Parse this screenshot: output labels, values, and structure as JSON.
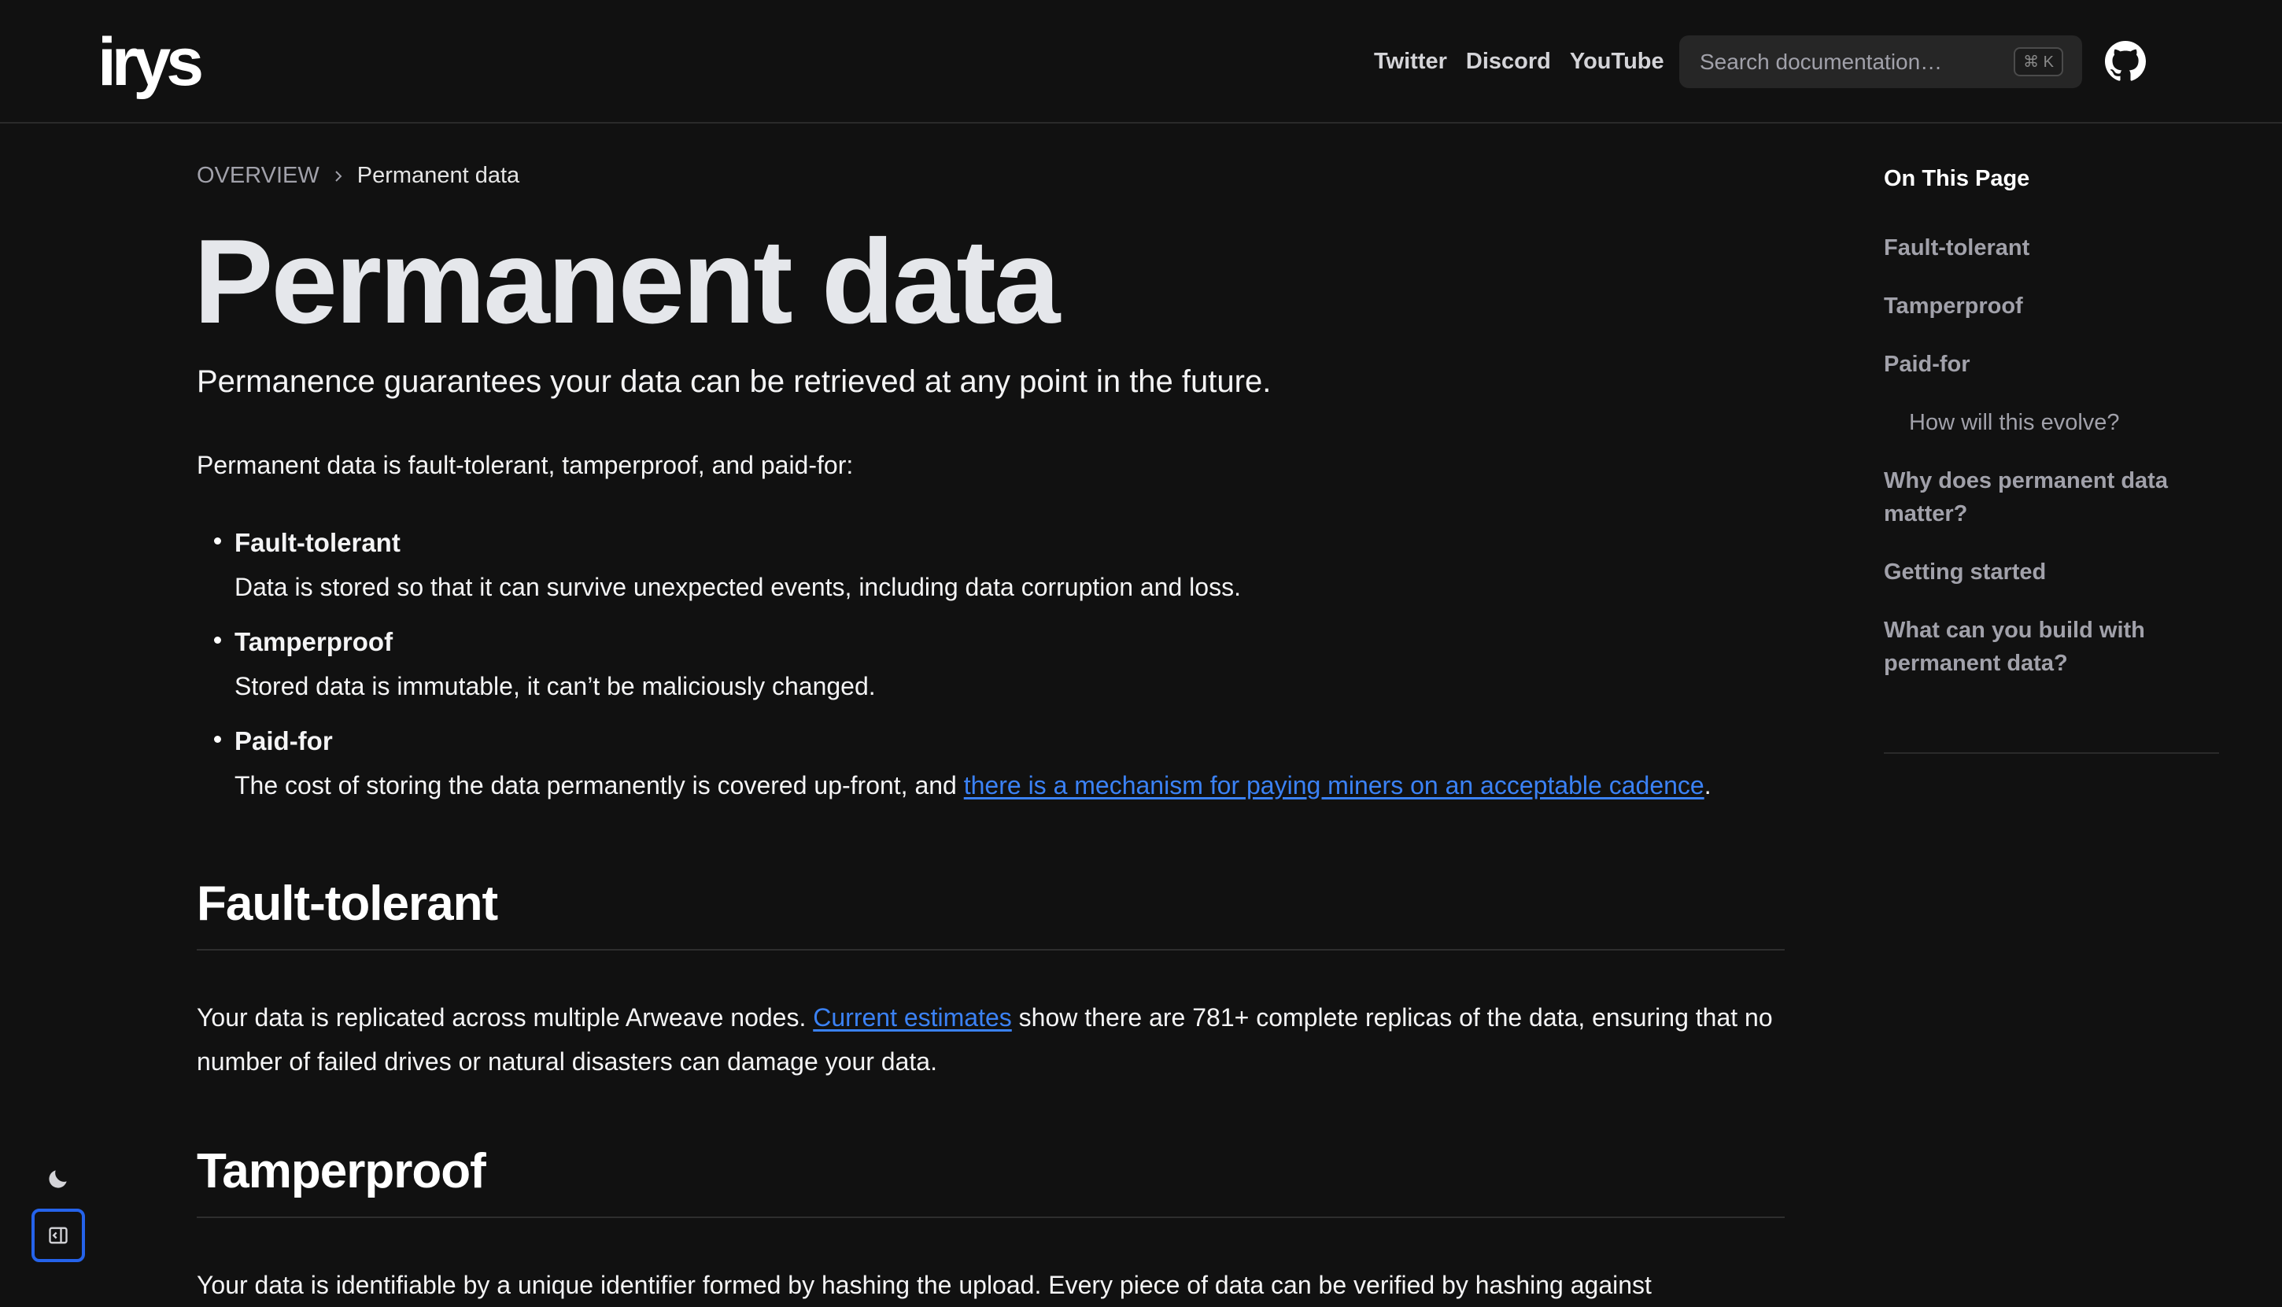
{
  "header": {
    "logo": "irys",
    "nav": [
      {
        "label": "Twitter"
      },
      {
        "label": "Discord"
      },
      {
        "label": "YouTube"
      }
    ],
    "search": {
      "placeholder": "Search documentation…",
      "shortcut": "⌘ K"
    },
    "github_icon": "github-icon"
  },
  "breadcrumb": {
    "parent": "OVERVIEW",
    "current": "Permanent data"
  },
  "page": {
    "title": "Permanent data",
    "subtitle": "Permanence guarantees your data can be retrieved at any point in the future.",
    "intro": "Permanent data is fault-tolerant, tamperproof, and paid-for:",
    "features": [
      {
        "title": "Fault-tolerant",
        "desc": "Data is stored so that it can survive unexpected events, including data corruption and loss."
      },
      {
        "title": "Tamperproof",
        "desc": "Stored data is immutable, it can’t be maliciously changed."
      },
      {
        "title": "Paid-for",
        "desc_before": "The cost of storing the data permanently is covered up-front, and ",
        "desc_link": "there is a mechanism for paying miners on an acceptable cadence",
        "desc_after": "."
      }
    ],
    "sections": {
      "fault_tolerant": {
        "heading": "Fault-tolerant",
        "text_before": "Your data is replicated across multiple Arweave nodes. ",
        "link": "Current estimates",
        "text_after": " show there are 781+ complete replicas of the data, ensuring that no number of failed drives or natural disasters can damage your data."
      },
      "tamperproof": {
        "heading": "Tamperproof",
        "text": "Your data is identifiable by a unique identifier formed by hashing the upload. Every piece of data can be verified by hashing against"
      }
    }
  },
  "toc": {
    "heading": "On This Page",
    "items": [
      {
        "label": "Fault-tolerant"
      },
      {
        "label": "Tamperproof"
      },
      {
        "label": "Paid-for"
      },
      {
        "label": "How will this evolve?"
      },
      {
        "label": "Why does permanent data matter?"
      },
      {
        "label": "Getting started"
      },
      {
        "label": "What can you build with permanent data?"
      }
    ]
  },
  "controls": {
    "theme_icon": "moon-icon",
    "sidebar_icon": "sidebar-toggle-icon",
    "accent": "#2563eb",
    "link_color": "#3b82f6"
  }
}
